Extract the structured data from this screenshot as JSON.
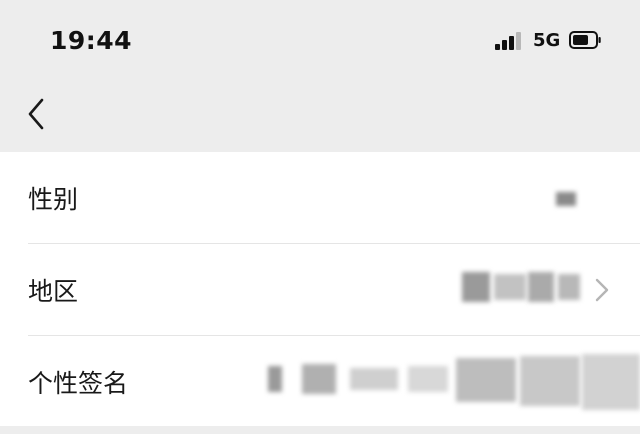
{
  "status_bar": {
    "time": "19:44",
    "network": "5G"
  },
  "nav": {
    "back_icon": "chevron-left-icon"
  },
  "rows": [
    {
      "label": "性别"
    },
    {
      "label": "地区"
    },
    {
      "label": "个性签名"
    }
  ],
  "colors": {
    "page_bg": "#ededed",
    "card_bg": "#ffffff",
    "text": "#191919",
    "divider": "#e5e5e5"
  }
}
